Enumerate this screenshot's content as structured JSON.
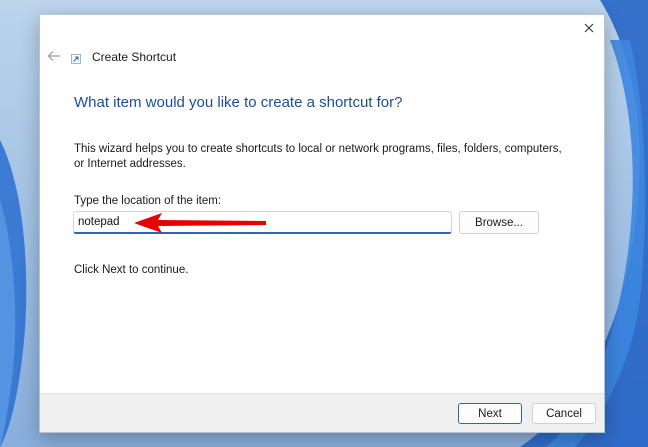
{
  "window": {
    "title": "Create Shortcut",
    "close_icon": "close-icon",
    "back_icon": "back-arrow-icon",
    "title_icon": "shortcut-arrow-icon"
  },
  "main": {
    "heading": "What item would you like to create a shortcut for?",
    "description": "This wizard helps you to create shortcuts to local or network programs, files, folders, computers, or Internet addresses.",
    "location_label": "Type the location of the item:",
    "location_value": "notepad",
    "browse_label": "Browse...",
    "continue_text": "Click Next to continue."
  },
  "footer": {
    "next_label": "Next",
    "cancel_label": "Cancel"
  },
  "colors": {
    "heading": "#1c4e9a",
    "accent": "#2a66b8",
    "annotation_arrow": "#e60000",
    "footer_bg": "#f0f0f0"
  }
}
